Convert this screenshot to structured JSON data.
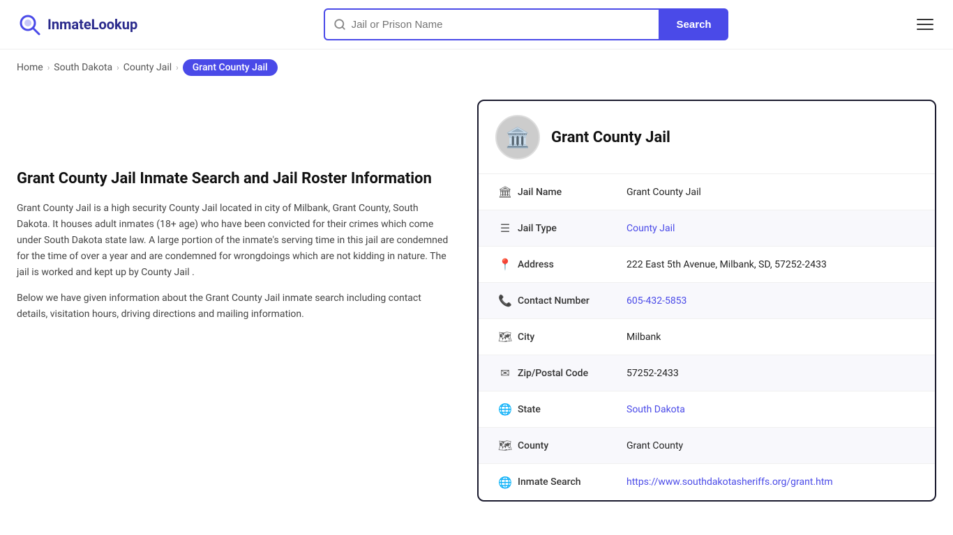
{
  "header": {
    "logo_text": "InmateLookup",
    "search_placeholder": "Jail or Prison Name",
    "search_button_label": "Search"
  },
  "breadcrumb": {
    "home_label": "Home",
    "state_label": "South Dakota",
    "type_label": "County Jail",
    "current_label": "Grant County Jail"
  },
  "left": {
    "heading": "Grant County Jail Inmate Search and Jail Roster Information",
    "para1": "Grant County Jail is a high security County Jail located in city of Milbank, Grant County, South Dakota. It houses adult inmates (18+ age) who have been convicted for their crimes which come under South Dakota state law. A large portion of the inmate's serving time in this jail are condemned for the time of over a year and are condemned for wrongdoings which are not kidding in nature. The jail is worked and kept up by County Jail .",
    "para2": "Below we have given information about the Grant County Jail inmate search including contact details, visitation hours, driving directions and mailing information."
  },
  "card": {
    "title": "Grant County Jail",
    "avatar_emoji": "🏛️",
    "rows": [
      {
        "icon": "🏛",
        "label": "Jail Name",
        "value": "Grant County Jail",
        "link": null,
        "name": "jail-name-row"
      },
      {
        "icon": "☰",
        "label": "Jail Type",
        "value": "County Jail",
        "link": "#",
        "name": "jail-type-row"
      },
      {
        "icon": "📍",
        "label": "Address",
        "value": "222 East 5th Avenue, Milbank, SD, 57252-2433",
        "link": null,
        "name": "address-row"
      },
      {
        "icon": "📞",
        "label": "Contact Number",
        "value": "605-432-5853",
        "link": "tel:605-432-5853",
        "name": "contact-row"
      },
      {
        "icon": "🗺",
        "label": "City",
        "value": "Milbank",
        "link": null,
        "name": "city-row"
      },
      {
        "icon": "✉",
        "label": "Zip/Postal Code",
        "value": "57252-2433",
        "link": null,
        "name": "zip-row"
      },
      {
        "icon": "🌐",
        "label": "State",
        "value": "South Dakota",
        "link": "#",
        "name": "state-row"
      },
      {
        "icon": "🗺",
        "label": "County",
        "value": "Grant County",
        "link": null,
        "name": "county-row"
      },
      {
        "icon": "🌐",
        "label": "Inmate Search",
        "value": "https://www.southdakotasheriffs.org/grant.htm",
        "link": "https://www.southdakotasheriffs.org/grant.htm",
        "name": "inmate-search-row"
      }
    ]
  }
}
